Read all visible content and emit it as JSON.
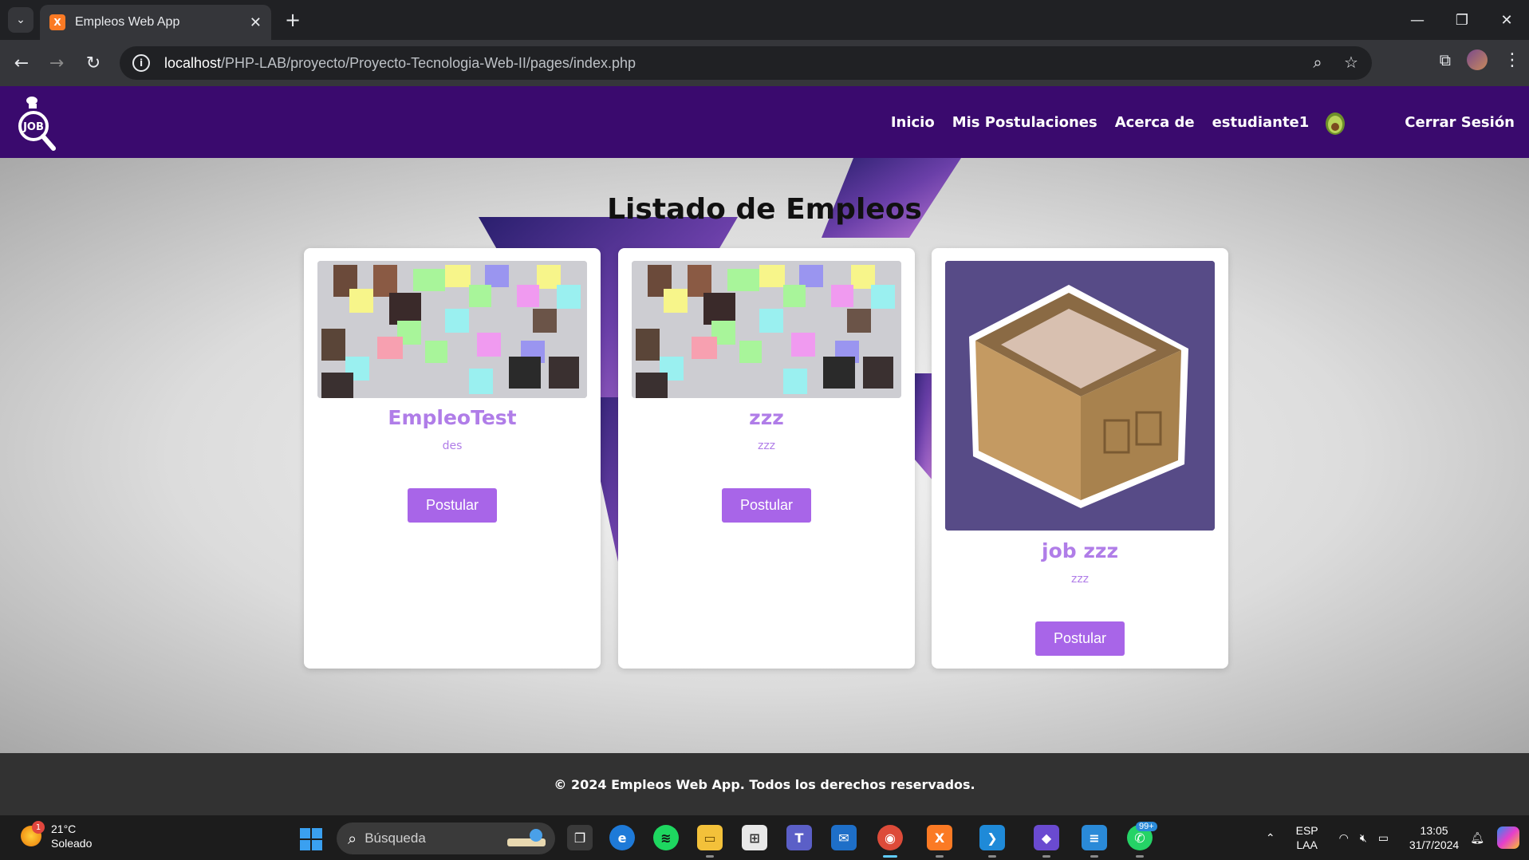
{
  "browser": {
    "tab_title": "Empleos Web App",
    "tab_favicon_glyph": "ቍ",
    "url_host": "localhost",
    "url_path": "/PHP-LAB/proyecto/Proyecto-Tecnologia-Web-II/pages/index.php"
  },
  "header": {
    "nav": [
      "Inicio",
      "Mis Postulaciones",
      "Acerca de",
      "estudiante1"
    ],
    "logout": "Cerrar Sesión",
    "brand_color": "#3a0a6e"
  },
  "main": {
    "title": "Listado de Empleos",
    "jobs": [
      {
        "title": "EmpleoTest",
        "description": "des",
        "button": "Postular",
        "image": "collage"
      },
      {
        "title": "zzz",
        "description": "zzz",
        "button": "Postular",
        "image": "collage"
      },
      {
        "title": "job zzz",
        "description": "zzz",
        "button": "Postular",
        "image": "cardboard-box"
      }
    ],
    "accent_color": "#a865e8"
  },
  "footer": {
    "text": "© 2024 Empleos Web App. Todos los derechos reservados."
  },
  "taskbar": {
    "temperature": "21°C",
    "condition": "Soleado",
    "weather_badge": "1",
    "search_placeholder": "Búsqueda",
    "whatsapp_badge": "99+",
    "lang": "ESP",
    "layout": "LAA",
    "time": "13:05",
    "date": "31/7/2024"
  }
}
